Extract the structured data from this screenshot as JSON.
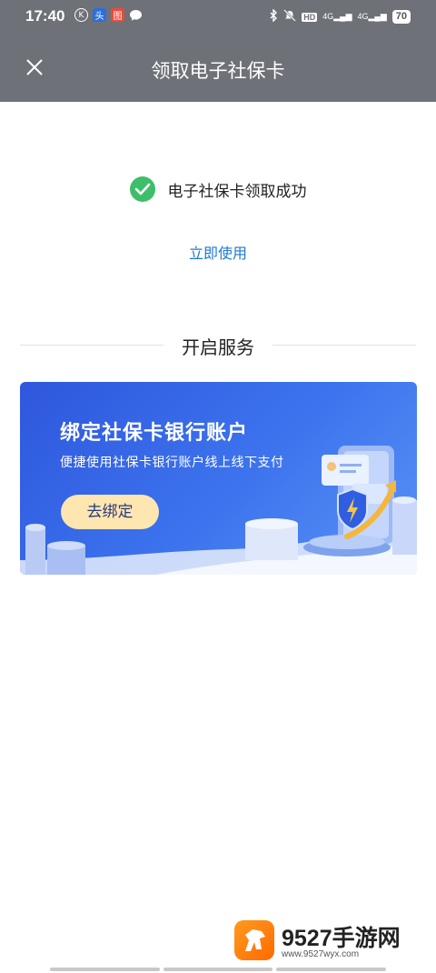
{
  "status_bar": {
    "time": "17:40",
    "network_a": "4G",
    "network_b": "4G",
    "hd": "HD",
    "battery": "70"
  },
  "header": {
    "title": "领取电子社保卡",
    "close_icon": "close-icon"
  },
  "success": {
    "icon": "check-circle-icon",
    "text": "电子社保卡领取成功"
  },
  "use_now_link": "立即使用",
  "section": {
    "title": "开启服务"
  },
  "banner": {
    "title": "绑定社保卡银行账户",
    "subtitle": "便捷使用社保卡银行账户线上线下支付",
    "button": "去绑定"
  },
  "watermark": {
    "brand": "9527手游网",
    "url": "www.9527wyx.com"
  },
  "colors": {
    "header_bg": "#6e7177",
    "link": "#1f78d6",
    "success_green": "#3fbe6a",
    "banner_blue": "#3d74ee",
    "button_bg": "#fde6b0"
  }
}
